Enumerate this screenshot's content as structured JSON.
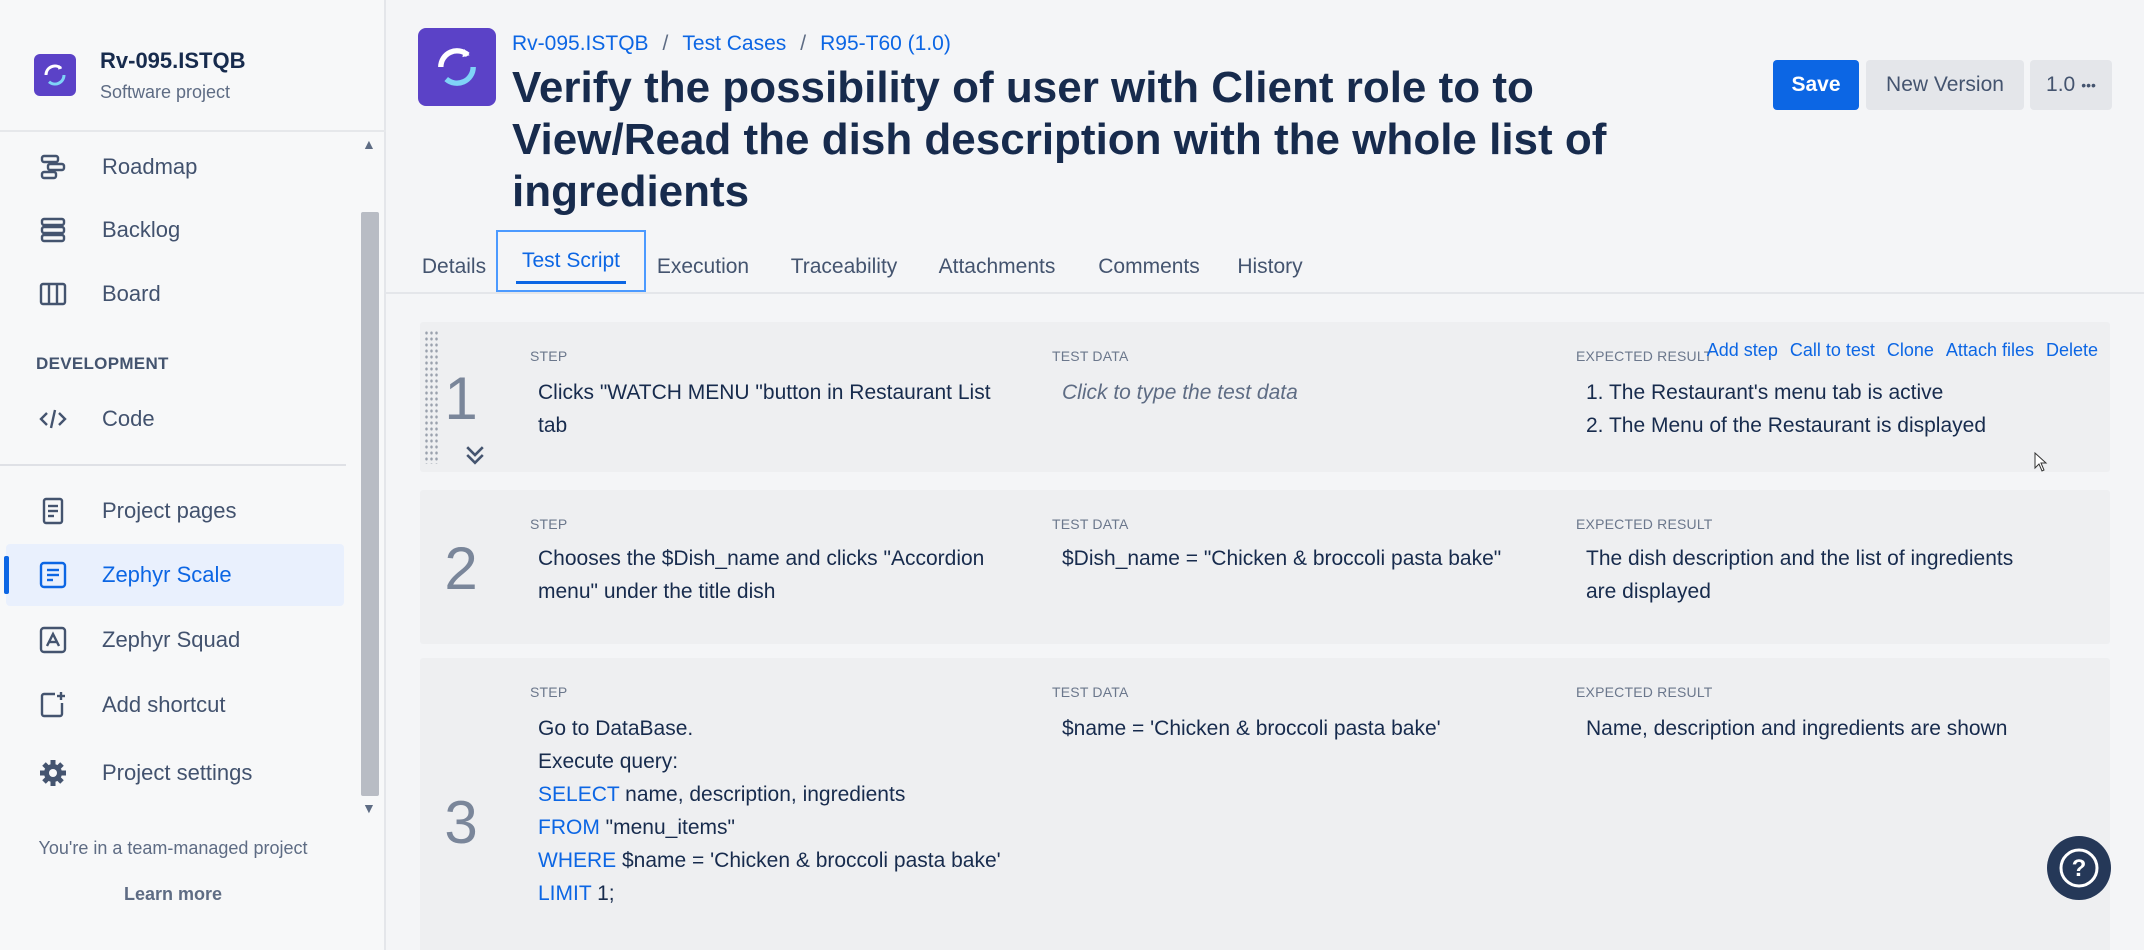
{
  "sidebar": {
    "project_name": "Rv-095.ISTQB",
    "project_type": "Software project",
    "items": [
      {
        "label": "Roadmap",
        "icon": "roadmap-icon"
      },
      {
        "label": "Backlog",
        "icon": "backlog-icon"
      },
      {
        "label": "Board",
        "icon": "board-icon"
      }
    ],
    "section_label": "DEVELOPMENT",
    "dev_items": [
      {
        "label": "Code",
        "icon": "code-icon"
      }
    ],
    "app_items": [
      {
        "label": "Project pages",
        "icon": "project-pages-icon"
      },
      {
        "label": "Zephyr Scale",
        "icon": "zephyr-scale-icon",
        "active": true
      },
      {
        "label": "Zephyr Squad",
        "icon": "zephyr-squad-icon"
      },
      {
        "label": "Add shortcut",
        "icon": "add-shortcut-icon"
      },
      {
        "label": "Project settings",
        "icon": "gear-icon"
      }
    ],
    "team_note": "You're in a team-managed project",
    "learn_more": "Learn more"
  },
  "breadcrumb": [
    "Rv-095.ISTQB",
    "Test Cases",
    "R95-T60 (1.0)"
  ],
  "title": "Verify the possibility of user with Client role to to View/Read the dish description with the whole list of ingredients",
  "buttons": {
    "save": "Save",
    "new_version": "New Version",
    "version": "1.0",
    "more": "•••"
  },
  "tabs": [
    "Details",
    "Test Script",
    "Execution",
    "Traceability",
    "Attachments",
    "Comments",
    "History"
  ],
  "active_tab": "Test Script",
  "columns": {
    "step": "STEP",
    "test_data": "TEST DATA",
    "expected": "EXPECTED RESULT"
  },
  "step_actions": [
    "Add step",
    "Call to test",
    "Clone",
    "Attach files",
    "Delete"
  ],
  "steps": [
    {
      "number": "1",
      "step": [
        "Clicks \"WATCH MENU \"button in Restaurant List",
        "tab"
      ],
      "test_data": "Click to type the test data",
      "expected": [
        "1. The Restaurant's menu tab is active",
        "2. The Menu of the Restaurant is displayed"
      ]
    },
    {
      "number": "2",
      "step": [
        "Chooses the $Dish_name and clicks \"Accordion",
        "menu\" under the title dish"
      ],
      "test_data": "$Dish_name = \"Chicken & broccoli pasta bake\"",
      "expected": [
        "The dish description and the list of ingredients",
        "are displayed"
      ]
    },
    {
      "number": "3",
      "step_lines": {
        "l1": "Go to DataBase.",
        "l2": "Execute query:",
        "l3_kw": "SELECT",
        "l3": " name, description, ingredients",
        "l4_kw": "FROM",
        "l4": " \"menu_items\"",
        "l5_kw": "WHERE",
        "l5": " $name = 'Chicken & broccoli pasta bake'",
        "l6_kw": "LIMIT",
        "l6": " 1;"
      },
      "test_data": "$name = 'Chicken & broccoli pasta bake'",
      "expected": [
        "Name, description and ingredients are shown"
      ]
    }
  ],
  "help_label": "?"
}
